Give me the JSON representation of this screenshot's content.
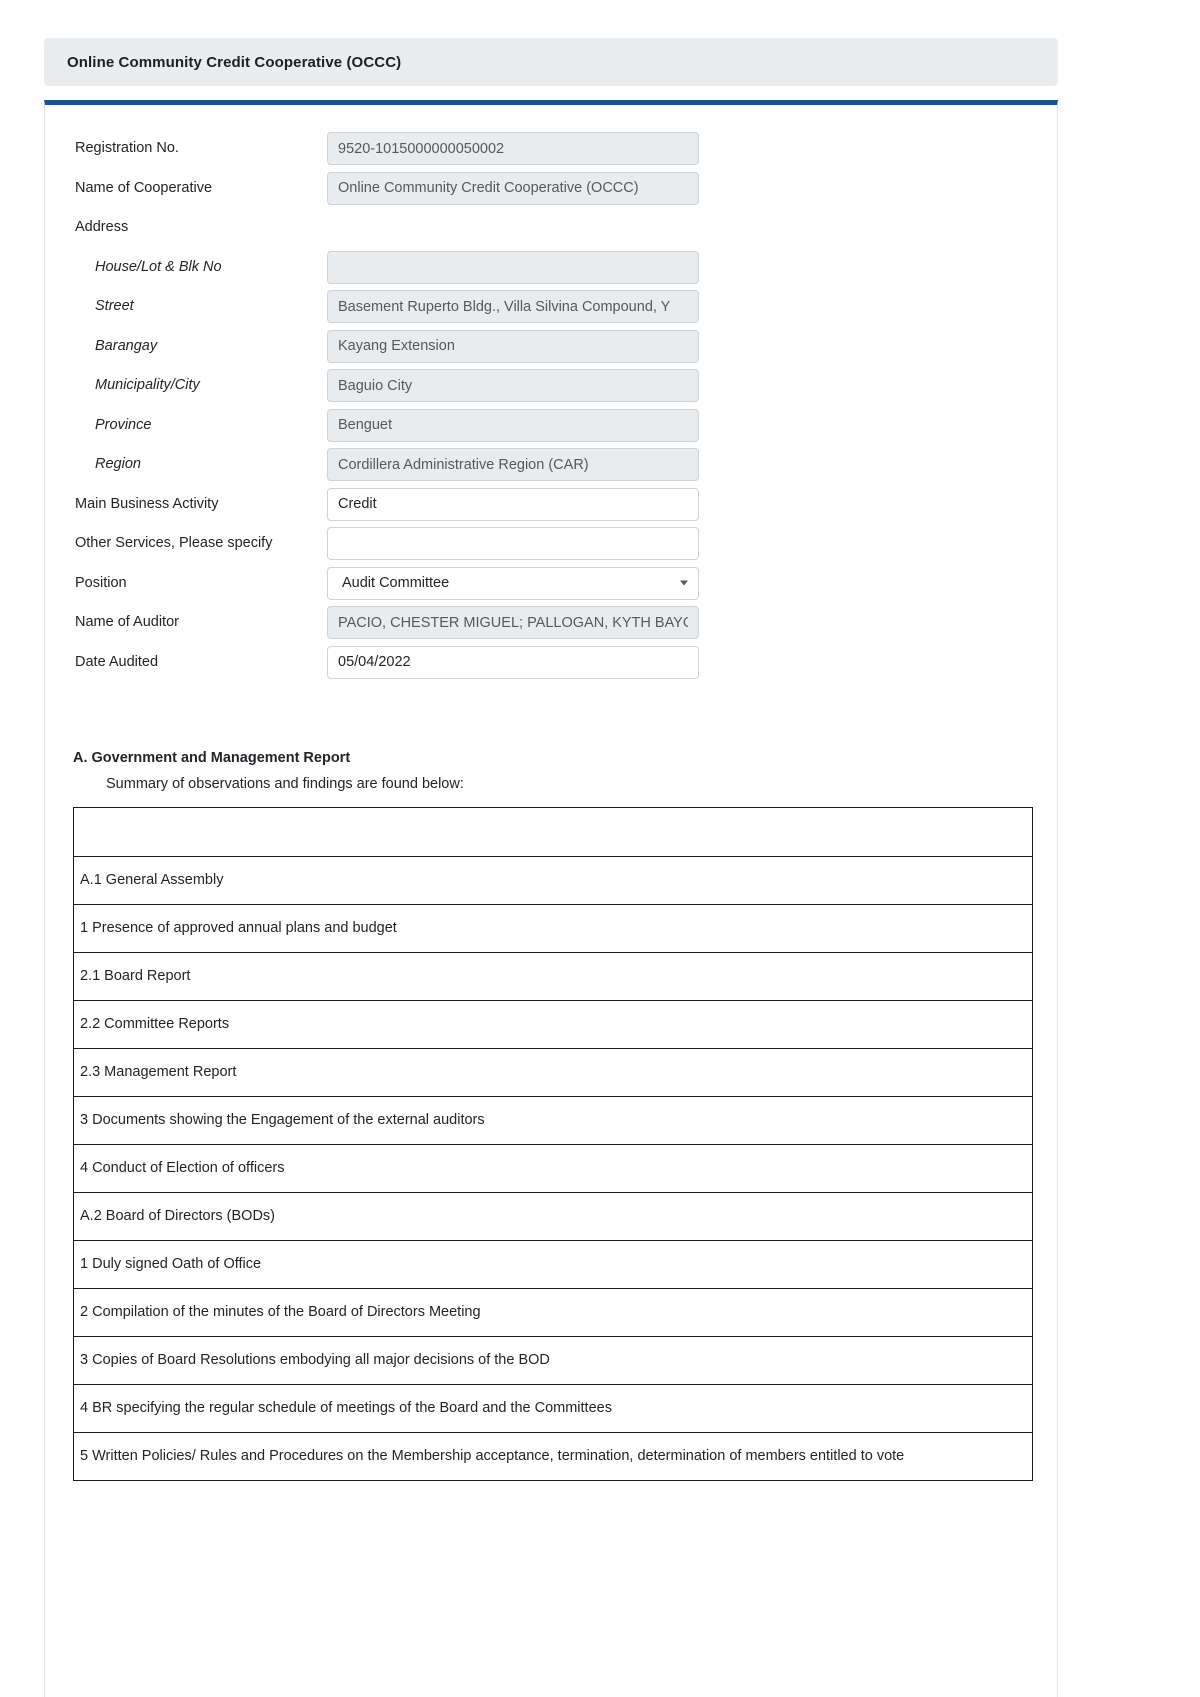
{
  "header": {
    "title": "Online Community Credit Cooperative (OCCC)"
  },
  "form": {
    "fields": [
      {
        "label": "Registration No.",
        "value": "9520-1015000000050002",
        "indent": false,
        "readonly": true,
        "type": "text"
      },
      {
        "label": "Name of Cooperative",
        "value": "Online Community Credit Cooperative (OCCC)",
        "indent": false,
        "readonly": true,
        "type": "text"
      },
      {
        "label": "Address",
        "value": "",
        "indent": false,
        "readonly": true,
        "type": "none"
      },
      {
        "label": "House/Lot & Blk No",
        "value": "",
        "indent": true,
        "readonly": true,
        "type": "text"
      },
      {
        "label": "Street",
        "value": "Basement Ruperto Bldg., Villa Silvina Compound, Y",
        "indent": true,
        "readonly": true,
        "type": "text"
      },
      {
        "label": "Barangay",
        "value": "Kayang Extension",
        "indent": true,
        "readonly": true,
        "type": "text"
      },
      {
        "label": "Municipality/City",
        "value": "Baguio City",
        "indent": true,
        "readonly": true,
        "type": "text"
      },
      {
        "label": "Province",
        "value": "Benguet",
        "indent": true,
        "readonly": true,
        "type": "text"
      },
      {
        "label": "Region",
        "value": "Cordillera Administrative Region (CAR)",
        "indent": true,
        "readonly": true,
        "type": "text"
      },
      {
        "label": "Main Business Activity",
        "value": "Credit",
        "indent": false,
        "readonly": false,
        "type": "text"
      },
      {
        "label": "Other Services, Please specify",
        "value": "",
        "indent": false,
        "readonly": false,
        "type": "text"
      },
      {
        "label": "Position",
        "value": "Audit Committee",
        "indent": false,
        "readonly": false,
        "type": "select"
      },
      {
        "label": "Name of Auditor",
        "value": "PACIO, CHESTER MIGUEL; PALLOGAN, KYTH BAYO",
        "indent": false,
        "readonly": true,
        "type": "text"
      },
      {
        "label": "Date Audited",
        "value": "05/04/2022",
        "indent": false,
        "readonly": false,
        "type": "text"
      }
    ],
    "position_options": [
      "Audit Committee"
    ]
  },
  "section_a": {
    "title": "A. Government and Management Report",
    "subtitle": "Summary of observations and findings are found below:"
  },
  "findings": {
    "rows": [
      {
        "text": "",
        "level": 0
      },
      {
        "text": "A.1 General Assembly",
        "level": 0
      },
      {
        "text": "1 Presence of approved annual plans and budget",
        "level": 1
      },
      {
        "text": "2.1 Board Report",
        "level": 2
      },
      {
        "text": "2.2 Committee Reports",
        "level": 2
      },
      {
        "text": "2.3 Management Report",
        "level": 2
      },
      {
        "text": "3 Documents showing the Engagement of the external auditors",
        "level": 1
      },
      {
        "text": "4 Conduct of Election of officers",
        "level": 1
      },
      {
        "text": "A.2 Board of Directors (BODs)",
        "level": 0
      },
      {
        "text": "1 Duly signed Oath of Office",
        "level": 1
      },
      {
        "text": "2 Compilation of the minutes of the Board of Directors Meeting",
        "level": 1
      },
      {
        "text": "3 Copies of Board Resolutions embodying all major decisions of the BOD",
        "level": 1
      },
      {
        "text": "4 BR specifying the regular schedule of meetings of the Board and the Committees",
        "level": 1
      },
      {
        "text": "5 Written Policies/ Rules and Procedures on the Membership acceptance, termination, determination of members entitled to vote",
        "level": 1
      }
    ]
  },
  "colors": {
    "header_bg": "#e9edf0",
    "card_accent": "#1a5490",
    "field_readonly_bg": "#e9ecef",
    "field_border": "#ced4da",
    "table_border": "#1b1b1b",
    "text": "#212529"
  }
}
